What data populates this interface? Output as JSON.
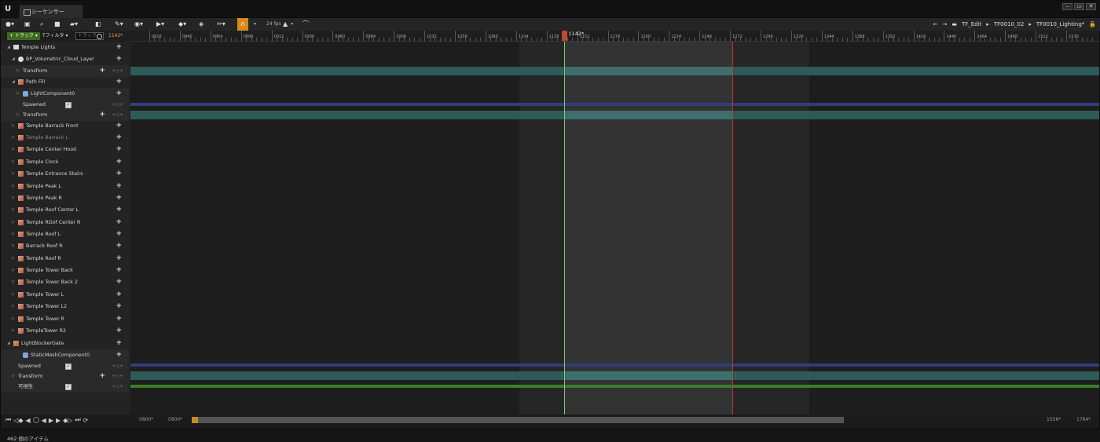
{
  "window": {
    "tab_title": "シーケンサー",
    "minimize": "–",
    "maximize": "▭",
    "close": "✕"
  },
  "toolbar": {
    "fps_label": "24 fps",
    "warning": "▲"
  },
  "breadcrumb": {
    "items": [
      "TF_Edit",
      "TF0010_02",
      "TF0010_Lighting*"
    ]
  },
  "filterbar": {
    "track_label": "+ トラック ▾",
    "filter_label": "Tフィルタ ▾",
    "search_placeholder": "トラック",
    "current_frame": "1142*"
  },
  "tree": [
    {
      "label": "Temple Lights",
      "depth": 0,
      "type": "folder",
      "tri": "◢"
    },
    {
      "label": "BP_Volumetric_Cloud_Layer",
      "depth": 1,
      "type": "actor",
      "tri": "◢"
    },
    {
      "label": "Transform",
      "depth": 2,
      "type": "track",
      "tri": "▷",
      "keys": "+◇+"
    },
    {
      "label": "Path Fill",
      "depth": 1,
      "type": "light",
      "tri": "◢"
    },
    {
      "label": "LightComponent0",
      "depth": 2,
      "type": "component",
      "tri": "▷"
    },
    {
      "label": "Spawned",
      "depth": 2,
      "type": "check",
      "tri": "",
      "keys": "+◇+"
    },
    {
      "label": "Transform",
      "depth": 2,
      "type": "track",
      "tri": "▷",
      "keys": "+◇+"
    },
    {
      "label": "Temple Barrack Front",
      "depth": 1,
      "type": "light",
      "tri": "▷"
    },
    {
      "label": "Temple Barrack L",
      "depth": 1,
      "type": "light",
      "tri": "▷",
      "dim": true
    },
    {
      "label": "Temple Center Hood",
      "depth": 1,
      "type": "light",
      "tri": "▷"
    },
    {
      "label": "Temple Clock",
      "depth": 1,
      "type": "light",
      "tri": "▷"
    },
    {
      "label": "Temple Entrance Stairs",
      "depth": 1,
      "type": "light",
      "tri": "▷"
    },
    {
      "label": "Temple Peak L",
      "depth": 1,
      "type": "light",
      "tri": "▷"
    },
    {
      "label": "Temple Peak R",
      "depth": 1,
      "type": "light",
      "tri": "▷"
    },
    {
      "label": "Temple Roof Center L",
      "depth": 1,
      "type": "light",
      "tri": "▷"
    },
    {
      "label": "Temple ROof Center R",
      "depth": 1,
      "type": "light",
      "tri": "▷"
    },
    {
      "label": "Temple Roof L",
      "depth": 1,
      "type": "light",
      "tri": "▷"
    },
    {
      "label": "Barrack Roof R",
      "depth": 1,
      "type": "light",
      "tri": "▷"
    },
    {
      "label": "Temple Roof R",
      "depth": 1,
      "type": "light",
      "tri": "▷"
    },
    {
      "label": "Temple Tower Back",
      "depth": 1,
      "type": "light",
      "tri": "▷"
    },
    {
      "label": "Temple Tower Back 2",
      "depth": 1,
      "type": "light",
      "tri": "▷"
    },
    {
      "label": "Temple Tower L",
      "depth": 1,
      "type": "light",
      "tri": "▷"
    },
    {
      "label": "Temple Tower L2",
      "depth": 1,
      "type": "light",
      "tri": "▷"
    },
    {
      "label": "Temple Tower R",
      "depth": 1,
      "type": "light",
      "tri": "▷"
    },
    {
      "label": "TempleTower R2",
      "depth": 1,
      "type": "light",
      "tri": "▷"
    },
    {
      "label": "LightBlockerGate",
      "depth": 0,
      "type": "light",
      "tri": "◢"
    },
    {
      "label": "StaticMeshComponent0",
      "depth": 2,
      "type": "component",
      "tri": ""
    },
    {
      "label": "Spawned",
      "depth": 1,
      "type": "check",
      "tri": "",
      "keys": "+◇+"
    },
    {
      "label": "Transform",
      "depth": 1,
      "type": "track",
      "tri": "▷",
      "keys": "+◇+"
    },
    {
      "label": "可視性",
      "depth": 1,
      "type": "check",
      "tri": "",
      "keys": "+◇+"
    }
  ],
  "item_count": "462 個のアイテム",
  "ruler": {
    "labels": [
      "0816",
      "0840",
      "0864",
      "0888",
      "0912",
      "0936",
      "0960",
      "0984",
      "1008",
      "1032",
      "1056",
      "1080",
      "1104",
      "1128",
      "1152",
      "1176",
      "1200",
      "1224",
      "1248",
      "1272",
      "1296",
      "1320",
      "1344",
      "1368",
      "1392",
      "1416",
      "1440",
      "1464",
      "1488",
      "1512",
      "1536"
    ],
    "playhead_label": "1142*"
  },
  "bottom": {
    "start_a": "0800*",
    "start_b": "0800*",
    "end_a": "1556*",
    "end_b": "1784*"
  },
  "colors": {
    "accent_green": "#3d6b1e",
    "playhead": "#c04a2c",
    "band": "#2e5a58"
  }
}
